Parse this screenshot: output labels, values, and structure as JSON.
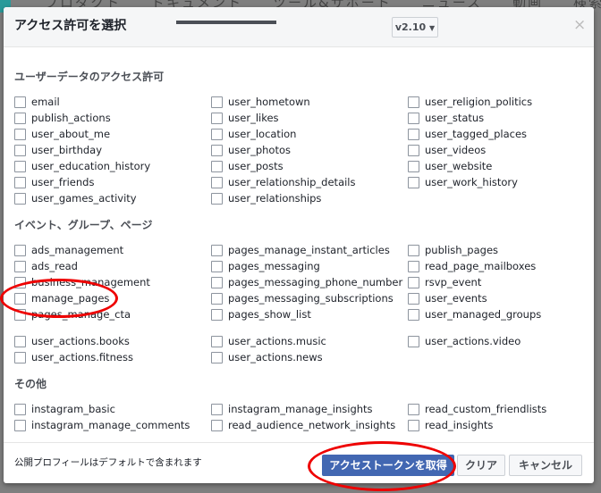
{
  "background_nav": [
    "プロダクト",
    "ドキュメント",
    "ツール&サポート",
    "ニュース",
    "動画",
    "検索"
  ],
  "dialog": {
    "title": "アクセス許可を選択",
    "version": "v2.10",
    "close": "×"
  },
  "sections": [
    {
      "title": "ユーザーデータのアクセス許可",
      "items": [
        "email",
        "user_hometown",
        "user_religion_politics",
        "publish_actions",
        "user_likes",
        "user_status",
        "user_about_me",
        "user_location",
        "user_tagged_places",
        "user_birthday",
        "user_photos",
        "user_videos",
        "user_education_history",
        "user_posts",
        "user_website",
        "user_friends",
        "user_relationship_details",
        "user_work_history",
        "user_games_activity",
        "user_relationships"
      ]
    },
    {
      "title": "イベント、グループ、ページ",
      "items": [
        "ads_management",
        "pages_manage_instant_articles",
        "publish_pages",
        "ads_read",
        "pages_messaging",
        "read_page_mailboxes",
        "business_management",
        "pages_messaging_phone_number",
        "rsvp_event",
        "manage_pages",
        "pages_messaging_subscriptions",
        "user_events",
        "pages_manage_cta",
        "pages_show_list",
        "user_managed_groups"
      ],
      "items2": [
        "user_actions.books",
        "user_actions.music",
        "user_actions.video",
        "user_actions.fitness",
        "user_actions.news"
      ]
    },
    {
      "title": "その他",
      "items": [
        "instagram_basic",
        "instagram_manage_insights",
        "read_custom_friendlists",
        "instagram_manage_comments",
        "read_audience_network_insights",
        "read_insights"
      ]
    }
  ],
  "footer": {
    "note": "公開プロフィールはデフォルトで含まれます",
    "get_token": "アクセストークンを取得",
    "clear": "クリア",
    "cancel": "キャンセル"
  },
  "colors": {
    "primary": "#4267b2",
    "annotation": "#e00000"
  }
}
